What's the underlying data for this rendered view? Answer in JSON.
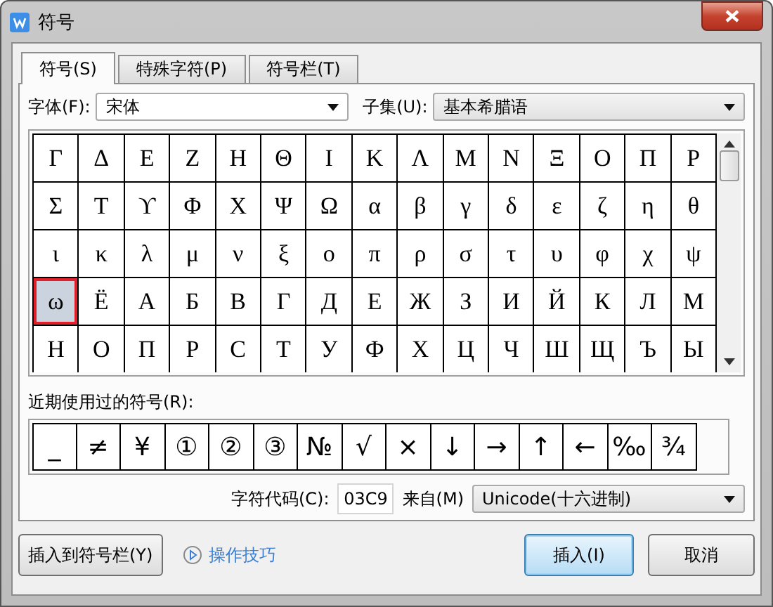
{
  "window": {
    "title": "符号"
  },
  "tabs": [
    {
      "label": "符号(S)",
      "selected": true
    },
    {
      "label": "特殊字符(P)",
      "selected": false
    },
    {
      "label": "符号栏(T)",
      "selected": false
    }
  ],
  "font": {
    "label": "字体(F):",
    "value": "宋体"
  },
  "subset": {
    "label": "子集(U):",
    "value": "基本希腊语"
  },
  "symbols": {
    "rows": [
      [
        {
          "char": "Γ",
          "selected": false
        },
        {
          "char": "Δ",
          "selected": false
        },
        {
          "char": "Ε",
          "selected": false
        },
        {
          "char": "Ζ",
          "selected": false
        },
        {
          "char": "Η",
          "selected": false
        },
        {
          "char": "Θ",
          "selected": false
        },
        {
          "char": "Ι",
          "selected": false
        },
        {
          "char": "Κ",
          "selected": false
        },
        {
          "char": "Λ",
          "selected": false
        },
        {
          "char": "Μ",
          "selected": false
        },
        {
          "char": "Ν",
          "selected": false
        },
        {
          "char": "Ξ",
          "selected": false
        },
        {
          "char": "Ο",
          "selected": false
        },
        {
          "char": "Π",
          "selected": false
        },
        {
          "char": "Ρ",
          "selected": false
        }
      ],
      [
        {
          "char": "Σ",
          "selected": false
        },
        {
          "char": "Τ",
          "selected": false
        },
        {
          "char": "ϒ",
          "selected": false
        },
        {
          "char": "Φ",
          "selected": false
        },
        {
          "char": "Χ",
          "selected": false
        },
        {
          "char": "Ψ",
          "selected": false
        },
        {
          "char": "Ω",
          "selected": false
        },
        {
          "char": "α",
          "selected": false
        },
        {
          "char": "β",
          "selected": false
        },
        {
          "char": "γ",
          "selected": false
        },
        {
          "char": "δ",
          "selected": false
        },
        {
          "char": "ε",
          "selected": false
        },
        {
          "char": "ζ",
          "selected": false
        },
        {
          "char": "η",
          "selected": false
        },
        {
          "char": "θ",
          "selected": false
        }
      ],
      [
        {
          "char": "ι",
          "selected": false
        },
        {
          "char": "κ",
          "selected": false
        },
        {
          "char": "λ",
          "selected": false
        },
        {
          "char": "μ",
          "selected": false
        },
        {
          "char": "ν",
          "selected": false
        },
        {
          "char": "ξ",
          "selected": false
        },
        {
          "char": "ο",
          "selected": false
        },
        {
          "char": "π",
          "selected": false
        },
        {
          "char": "ρ",
          "selected": false
        },
        {
          "char": "σ",
          "selected": false
        },
        {
          "char": "τ",
          "selected": false
        },
        {
          "char": "υ",
          "selected": false
        },
        {
          "char": "φ",
          "selected": false
        },
        {
          "char": "χ",
          "selected": false
        },
        {
          "char": "ψ",
          "selected": false
        }
      ],
      [
        {
          "char": "ω",
          "selected": true
        },
        {
          "char": "Ё",
          "selected": false
        },
        {
          "char": "А",
          "selected": false
        },
        {
          "char": "Б",
          "selected": false
        },
        {
          "char": "В",
          "selected": false
        },
        {
          "char": "Г",
          "selected": false
        },
        {
          "char": "Д",
          "selected": false
        },
        {
          "char": "Е",
          "selected": false
        },
        {
          "char": "Ж",
          "selected": false
        },
        {
          "char": "З",
          "selected": false
        },
        {
          "char": "И",
          "selected": false
        },
        {
          "char": "Й",
          "selected": false
        },
        {
          "char": "К",
          "selected": false
        },
        {
          "char": "Л",
          "selected": false
        },
        {
          "char": "М",
          "selected": false
        }
      ],
      [
        {
          "char": "Н",
          "selected": false
        },
        {
          "char": "О",
          "selected": false
        },
        {
          "char": "П",
          "selected": false
        },
        {
          "char": "Р",
          "selected": false
        },
        {
          "char": "С",
          "selected": false
        },
        {
          "char": "Т",
          "selected": false
        },
        {
          "char": "У",
          "selected": false
        },
        {
          "char": "Ф",
          "selected": false
        },
        {
          "char": "Х",
          "selected": false
        },
        {
          "char": "Ц",
          "selected": false
        },
        {
          "char": "Ч",
          "selected": false
        },
        {
          "char": "Ш",
          "selected": false
        },
        {
          "char": "Щ",
          "selected": false
        },
        {
          "char": "Ъ",
          "selected": false
        },
        {
          "char": "Ы",
          "selected": false
        }
      ]
    ]
  },
  "recent": {
    "label": "近期使用过的符号(R):",
    "symbols": [
      "_",
      "≠",
      "¥",
      "①",
      "②",
      "③",
      "№",
      "√",
      "×",
      "↓",
      "→",
      "↑",
      "←",
      "‰",
      "¾"
    ]
  },
  "char_code": {
    "label": "字符代码(C):",
    "value": "03C9"
  },
  "from": {
    "label": "来自(M)",
    "value": "Unicode(十六进制)"
  },
  "buttons": [
    {
      "label": "插入到符号栏(Y)",
      "kind": "normal"
    },
    {
      "label": "操作技巧",
      "kind": "link"
    },
    {
      "label": "插入(I)",
      "kind": "default"
    },
    {
      "label": "取消",
      "kind": "normal"
    }
  ]
}
